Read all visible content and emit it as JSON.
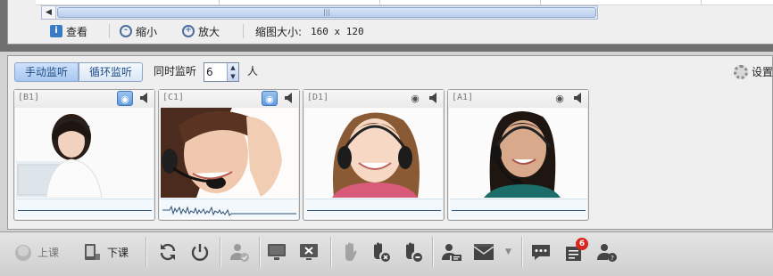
{
  "thumbnail_toolbar": {
    "view_label": "查看",
    "zoom_out_label": "缩小",
    "zoom_in_label": "放大",
    "thumb_size_label": "缩图大小:",
    "thumb_size_value": "160 x 120"
  },
  "monitor_bar": {
    "manual_tab": "手动监听",
    "cycle_tab": "循环监听",
    "simultaneous_label": "同时监听",
    "simultaneous_value": "6",
    "persons_label": "人",
    "settings_label": "设置"
  },
  "students": [
    {
      "label": "[B1]",
      "camera_active": true
    },
    {
      "label": "[C1]",
      "camera_active": true
    },
    {
      "label": "[D1]",
      "camera_active": false
    },
    {
      "label": "[A1]",
      "camera_active": false
    }
  ],
  "bottom_toolbar": {
    "start_class_label": "上课",
    "end_class_label": "下课",
    "message_badge_count": "6"
  },
  "icons": [
    "view-info-icon",
    "zoom-out-icon",
    "zoom-in-icon",
    "camera-icon",
    "speaker-icon",
    "gear-icon",
    "start-class-icon",
    "end-class-icon",
    "refresh-icon",
    "power-icon",
    "user-check-icon",
    "monitor-icon",
    "black-screen-icon",
    "raise-hand-icon",
    "hand-cancel-icon",
    "hand-minus-icon",
    "user-card-icon",
    "envelope-icon",
    "chat-icon",
    "document-icon",
    "user-help-icon"
  ]
}
